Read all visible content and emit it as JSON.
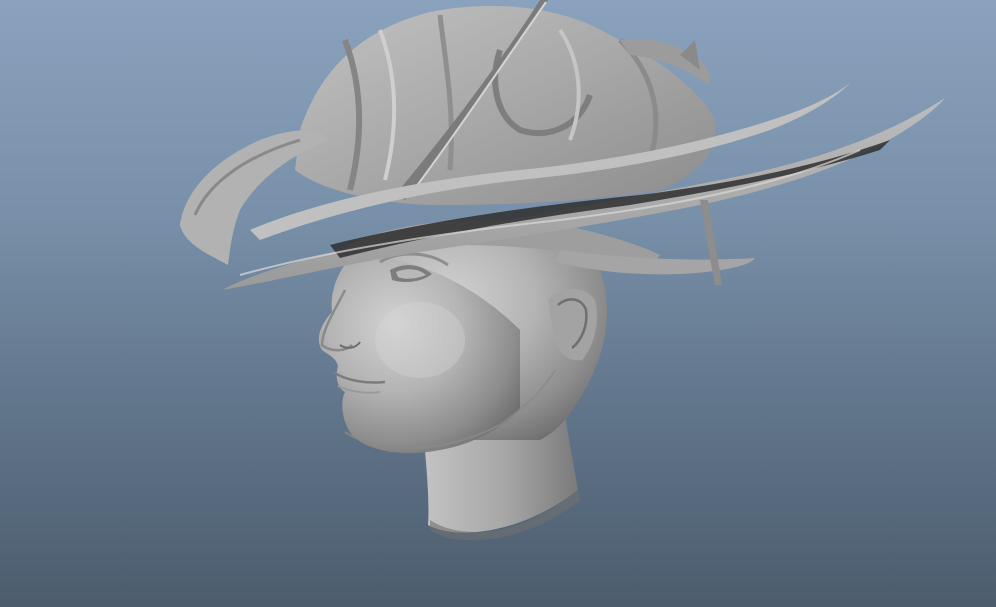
{
  "viewport": {
    "background_top": "#8aa2bd",
    "background_bottom": "#4c5c6d"
  },
  "model": {
    "type": "3d-render",
    "subject": "head-with-hat",
    "material_color": "#a9a9a9",
    "highlight_color": "#c9c9c9",
    "shadow_color": "#6f6f6f",
    "deep_shadow_color": "#2e2e2e"
  }
}
